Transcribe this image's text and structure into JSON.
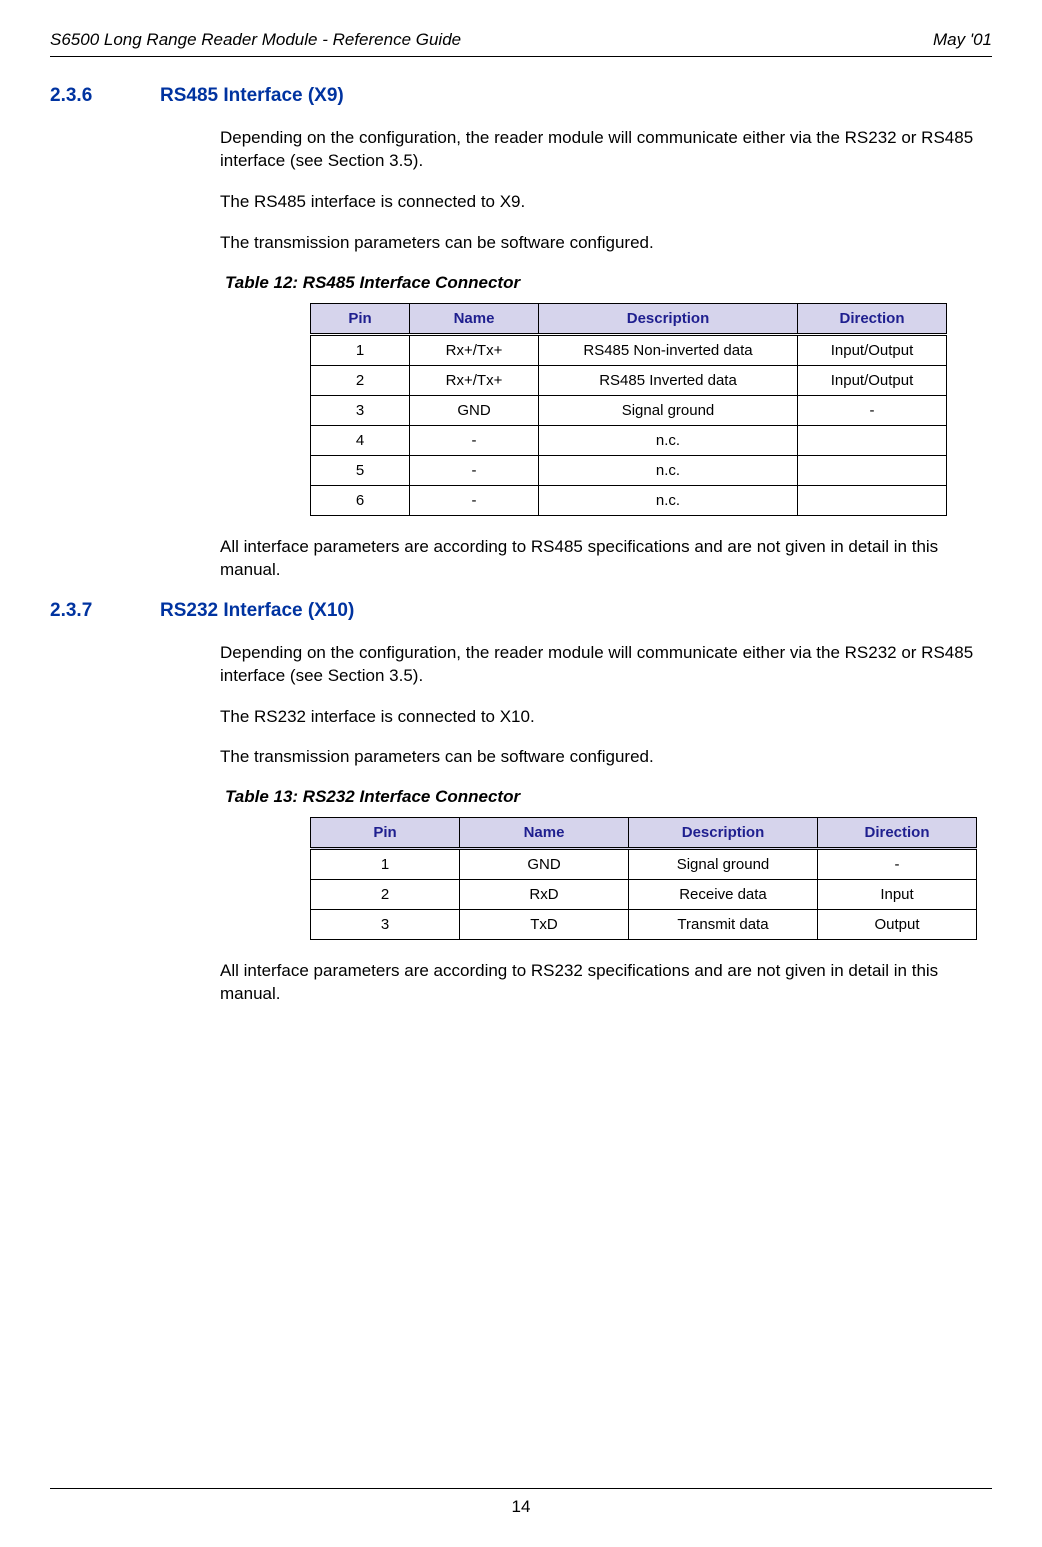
{
  "header": {
    "left": "S6500 Long Range Reader Module - Reference Guide",
    "right": "May '01"
  },
  "section236": {
    "number": "2.3.6",
    "title": "RS485 Interface (X9)",
    "para1": "Depending on the configuration, the reader module will communicate either via the RS232 or RS485 interface (see Section 3.5).",
    "para2": "The RS485 interface is connected to X9.",
    "para3": "The transmission parameters can be software configured.",
    "tableCaption": "Table 12: RS485 Interface Connector",
    "tableHeaders": {
      "c1": "Pin",
      "c2": "Name",
      "c3": "Description",
      "c4": "Direction"
    },
    "rows": [
      {
        "pin": "1",
        "name": "Rx+/Tx+",
        "desc": "RS485 Non-inverted data",
        "dir": "Input/Output"
      },
      {
        "pin": "2",
        "name": "Rx+/Tx+",
        "desc": "RS485 Inverted data",
        "dir": "Input/Output"
      },
      {
        "pin": "3",
        "name": "GND",
        "desc": "Signal ground",
        "dir": "-"
      },
      {
        "pin": "4",
        "name": "-",
        "desc": "n.c.",
        "dir": ""
      },
      {
        "pin": "5",
        "name": "-",
        "desc": "n.c.",
        "dir": ""
      },
      {
        "pin": "6",
        "name": "-",
        "desc": "n.c.",
        "dir": ""
      }
    ],
    "para4": "All interface parameters are according to RS485 specifications and are not given in detail in this manual."
  },
  "section237": {
    "number": "2.3.7",
    "title": "RS232 Interface (X10)",
    "para1": "Depending on the configuration, the reader module will communicate either via the RS232 or RS485 interface (see Section 3.5).",
    "para2": "The RS232 interface is connected to X10.",
    "para3": "The transmission parameters can be software configured.",
    "tableCaption": "Table 13: RS232 Interface Connector",
    "tableHeaders": {
      "c1": "Pin",
      "c2": "Name",
      "c3": "Description",
      "c4": "Direction"
    },
    "rows": [
      {
        "pin": "1",
        "name": "GND",
        "desc": "Signal ground",
        "dir": "-"
      },
      {
        "pin": "2",
        "name": "RxD",
        "desc": "Receive data",
        "dir": "Input"
      },
      {
        "pin": "3",
        "name": "TxD",
        "desc": "Transmit data",
        "dir": "Output"
      }
    ],
    "para4": "All interface parameters are according to RS232 specifications and are not given in detail in this manual."
  },
  "footer": {
    "pageNum": "14"
  }
}
